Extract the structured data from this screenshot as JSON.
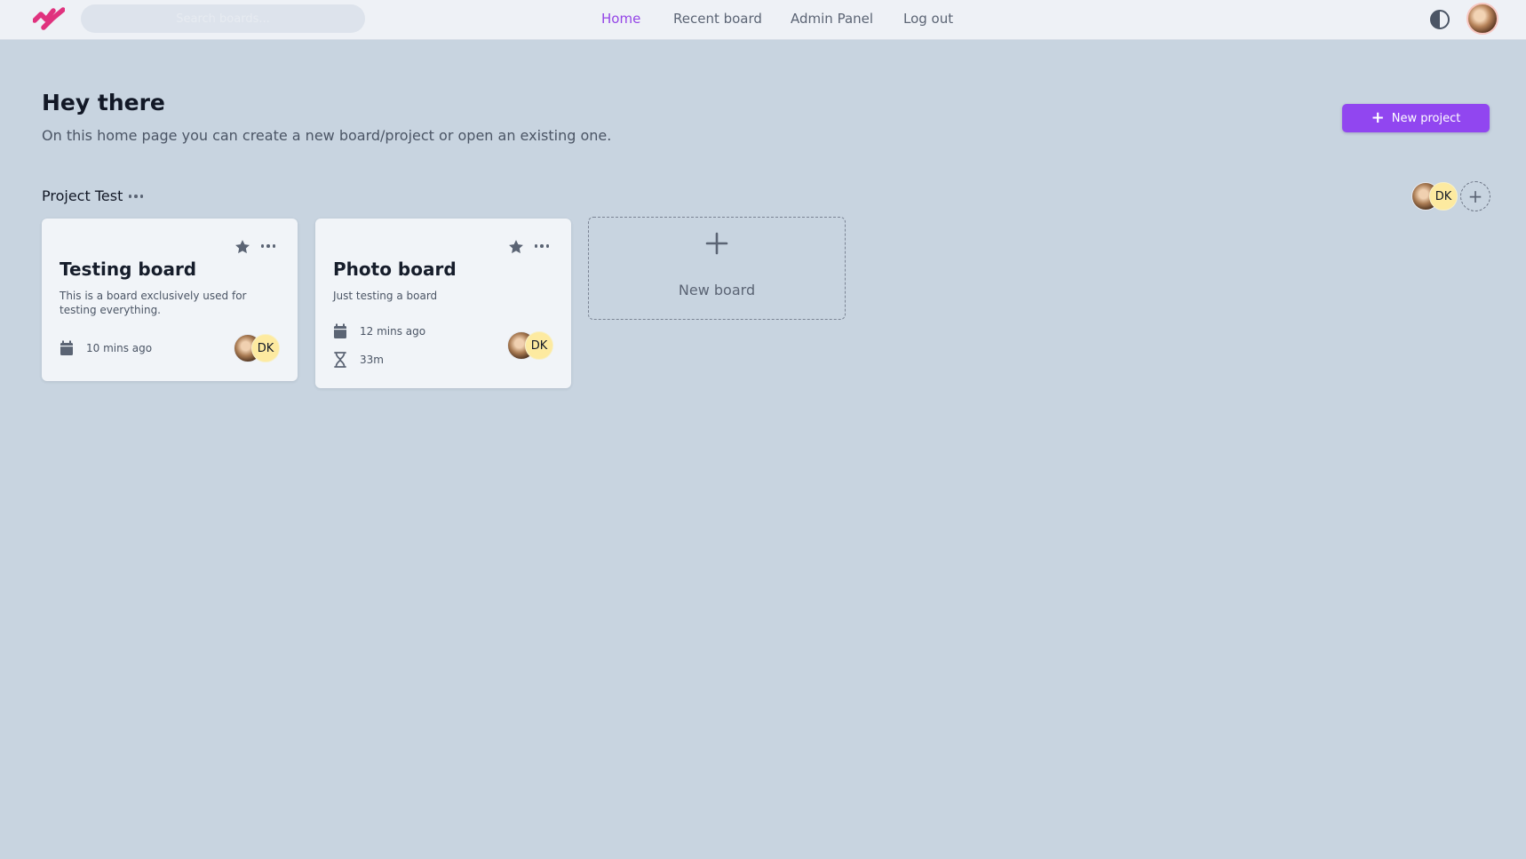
{
  "header": {
    "search_placeholder": "Search boards...",
    "nav": [
      {
        "label": "Home",
        "active": true
      },
      {
        "label": "Recent board",
        "active": false
      },
      {
        "label": "Admin Panel",
        "active": false
      },
      {
        "label": "Log out",
        "active": false
      }
    ]
  },
  "page": {
    "greeting": "Hey there",
    "intro": "On this home page you can create a new board/project or open an existing one.",
    "new_project_label": "New project"
  },
  "project": {
    "title": "Project Test",
    "member_initials": "DK",
    "boards": [
      {
        "title": "Testing board",
        "description": "This is a board exclusively used for testing everything.",
        "updated": "10 mins ago",
        "member_initials": "DK"
      },
      {
        "title": "Photo board",
        "description": "Just testing a board",
        "updated": "12 mins ago",
        "time_spent": "33m",
        "member_initials": "DK"
      }
    ],
    "new_board_label": "New board"
  },
  "colors": {
    "accent": "#9146f0",
    "active_nav": "#9445e6",
    "logo": "#e0327e",
    "background": "#c8d4e0",
    "card": "#f1f4f8"
  },
  "icons": {
    "logo": "brand-logo",
    "theme": "contrast-icon",
    "favorite": "star-icon",
    "menu": "more-horizontal-icon",
    "date": "calendar-icon",
    "duration": "hourglass-icon",
    "add": "plus-icon"
  }
}
